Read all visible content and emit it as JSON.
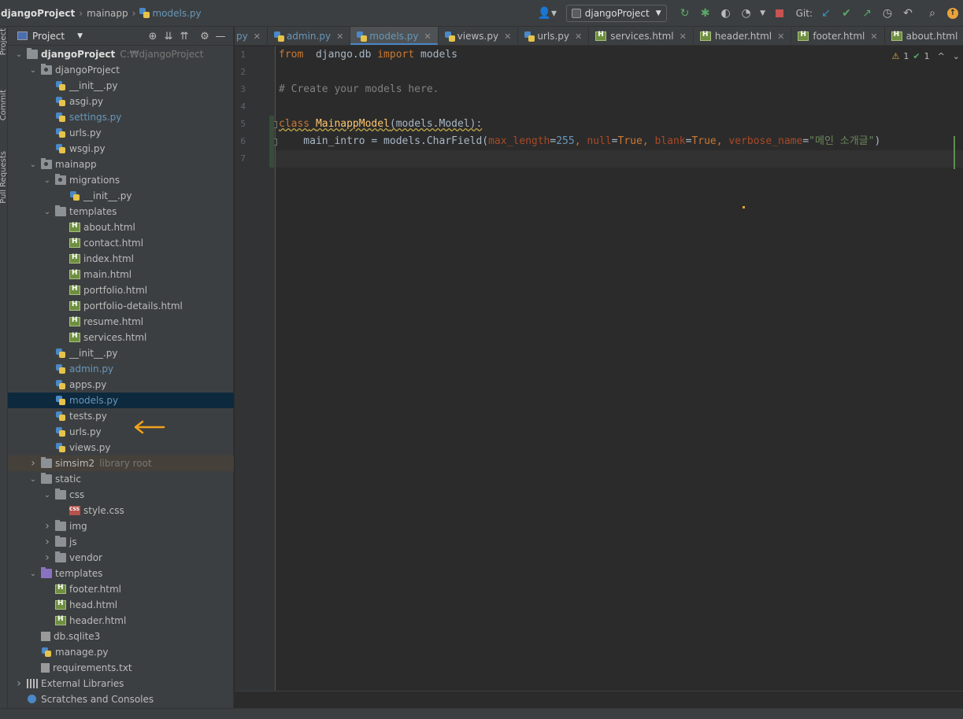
{
  "breadcrumb": {
    "project": "djangoProject",
    "folder": "mainapp",
    "file": "models.py"
  },
  "toolbar": {
    "run_config": "djangoProject",
    "git_label": "Git:"
  },
  "left_strip": {
    "project_tab": "Project",
    "commit_tab": "Commit",
    "pull_requests_tab": "Pull Requests"
  },
  "project_panel": {
    "title": "Project",
    "tree": [
      {
        "label": "djangoProject",
        "hint": "C:₩djangoProject",
        "type": "folder",
        "indent": 0,
        "expanded": true,
        "bold": true
      },
      {
        "label": "djangoProject",
        "type": "pkg",
        "indent": 1,
        "expanded": true
      },
      {
        "label": "__init__.py",
        "type": "py",
        "indent": 2
      },
      {
        "label": "asgi.py",
        "type": "py",
        "indent": 2
      },
      {
        "label": "settings.py",
        "type": "py",
        "indent": 2,
        "blue": true
      },
      {
        "label": "urls.py",
        "type": "py",
        "indent": 2
      },
      {
        "label": "wsgi.py",
        "type": "py",
        "indent": 2
      },
      {
        "label": "mainapp",
        "type": "pkg",
        "indent": 1,
        "expanded": true
      },
      {
        "label": "migrations",
        "type": "pkg",
        "indent": 2,
        "expanded": true
      },
      {
        "label": "__init__.py",
        "type": "py",
        "indent": 3
      },
      {
        "label": "templates",
        "type": "folder",
        "indent": 2,
        "expanded": true
      },
      {
        "label": "about.html",
        "type": "html",
        "indent": 3
      },
      {
        "label": "contact.html",
        "type": "html",
        "indent": 3
      },
      {
        "label": "index.html",
        "type": "html",
        "indent": 3
      },
      {
        "label": "main.html",
        "type": "html",
        "indent": 3
      },
      {
        "label": "portfolio.html",
        "type": "html",
        "indent": 3
      },
      {
        "label": "portfolio-details.html",
        "type": "html",
        "indent": 3
      },
      {
        "label": "resume.html",
        "type": "html",
        "indent": 3
      },
      {
        "label": "services.html",
        "type": "html",
        "indent": 3
      },
      {
        "label": "__init__.py",
        "type": "py",
        "indent": 2
      },
      {
        "label": "admin.py",
        "type": "py",
        "indent": 2,
        "blue": true
      },
      {
        "label": "apps.py",
        "type": "py",
        "indent": 2
      },
      {
        "label": "models.py",
        "type": "py",
        "indent": 2,
        "blue": true,
        "selected": true
      },
      {
        "label": "tests.py",
        "type": "py",
        "indent": 2
      },
      {
        "label": "urls.py",
        "type": "py",
        "indent": 2
      },
      {
        "label": "views.py",
        "type": "py",
        "indent": 2
      },
      {
        "label": "simsim2",
        "hint": "library root",
        "type": "folder",
        "indent": 1,
        "expanded": false,
        "lib": true
      },
      {
        "label": "static",
        "type": "folder",
        "indent": 1,
        "expanded": true
      },
      {
        "label": "css",
        "type": "folder",
        "indent": 2,
        "expanded": true
      },
      {
        "label": "style.css",
        "type": "css",
        "indent": 3
      },
      {
        "label": "img",
        "type": "folder",
        "indent": 2,
        "expanded": false
      },
      {
        "label": "js",
        "type": "folder",
        "indent": 2,
        "expanded": false
      },
      {
        "label": "vendor",
        "type": "folder",
        "indent": 2,
        "expanded": false
      },
      {
        "label": "templates",
        "type": "purple",
        "indent": 1,
        "expanded": true
      },
      {
        "label": "footer.html",
        "type": "html",
        "indent": 2
      },
      {
        "label": "head.html",
        "type": "html",
        "indent": 2
      },
      {
        "label": "header.html",
        "type": "html",
        "indent": 2
      },
      {
        "label": "db.sqlite3",
        "type": "db",
        "indent": 1
      },
      {
        "label": "manage.py",
        "type": "py",
        "indent": 1
      },
      {
        "label": "requirements.txt",
        "type": "txt",
        "indent": 1
      },
      {
        "label": "External Libraries",
        "type": "libs",
        "indent": 0,
        "expanded": false
      },
      {
        "label": "Scratches and Consoles",
        "type": "scratch",
        "indent": 0,
        "leaf": true
      }
    ]
  },
  "tabs": [
    {
      "label": "py",
      "partial": true
    },
    {
      "label": "admin.py",
      "type": "py",
      "blue": true
    },
    {
      "label": "models.py",
      "type": "py",
      "active": true
    },
    {
      "label": "views.py",
      "type": "py"
    },
    {
      "label": "urls.py",
      "type": "py"
    },
    {
      "label": "services.html",
      "type": "html"
    },
    {
      "label": "header.html",
      "type": "html"
    },
    {
      "label": "footer.html",
      "type": "html"
    },
    {
      "label": "about.html",
      "type": "html"
    },
    {
      "label": "",
      "type": "html",
      "partial": true
    }
  ],
  "editor": {
    "warnings": "1",
    "weak_warnings": "1",
    "lines": [
      {
        "n": "1",
        "tokens": [
          [
            "kw",
            "from"
          ],
          [
            "",
            "  django.db "
          ],
          [
            "kw",
            "import"
          ],
          [
            "",
            " models"
          ]
        ]
      },
      {
        "n": "2",
        "tokens": []
      },
      {
        "n": "3",
        "tokens": [
          [
            "cm",
            "# Create your models here."
          ]
        ]
      },
      {
        "n": "4",
        "tokens": []
      },
      {
        "n": "5",
        "tokens": [
          [
            "kw wavy",
            "class"
          ],
          [
            "wavy",
            " "
          ],
          [
            "cls wavy",
            "MainappModel"
          ],
          [
            "wavy",
            "(models.Model):"
          ]
        ]
      },
      {
        "n": "6",
        "tokens": [
          [
            "",
            "    main_intro = models.CharField("
          ],
          [
            "pa",
            "max_length"
          ],
          [
            "",
            "="
          ],
          [
            "nm",
            "255"
          ],
          [
            "kw",
            ", "
          ],
          [
            "pa",
            "null"
          ],
          [
            "",
            "="
          ],
          [
            "kw",
            "True"
          ],
          [
            "kw",
            ", "
          ],
          [
            "pa",
            "blank"
          ],
          [
            "",
            "="
          ],
          [
            "kw",
            "True"
          ],
          [
            "kw",
            ", "
          ],
          [
            "pa",
            "verbose_name"
          ],
          [
            "",
            "="
          ],
          [
            "st",
            "\"메인 소개글\""
          ],
          [
            "",
            ")"
          ]
        ]
      },
      {
        "n": "7",
        "tokens": [],
        "current": true
      }
    ]
  },
  "colors": {
    "accent": "#4a88c7",
    "selection": "#0d293e",
    "annotation_arrow": "#f0a21f"
  }
}
